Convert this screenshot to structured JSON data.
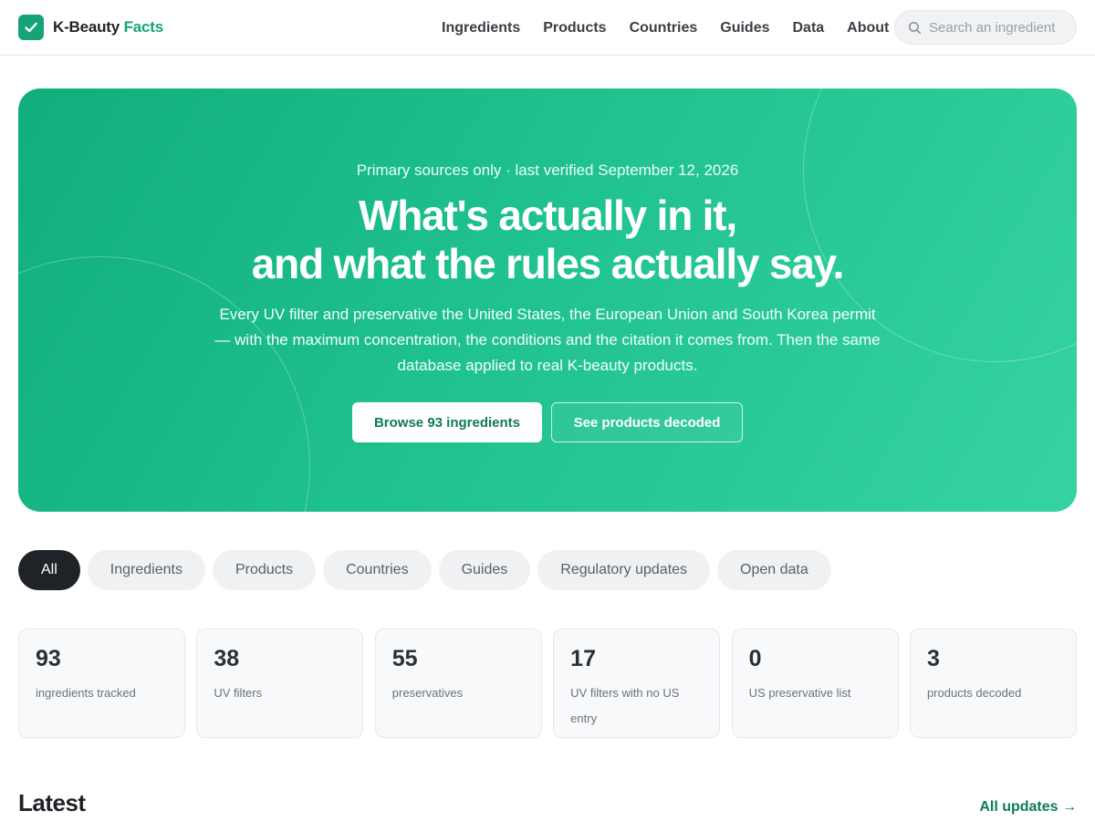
{
  "brand": {
    "name": "K-Beauty",
    "accent": "Facts",
    "color": "#16a37a"
  },
  "nav": [
    "Ingredients",
    "Products",
    "Countries",
    "Guides",
    "Data",
    "About"
  ],
  "search": {
    "placeholder": "Search an ingredient",
    "value": ""
  },
  "hero": {
    "eyebrow": "Primary sources only · last verified September 12, 2026",
    "title_line1": "What's actually in it,",
    "title_line2": "and what the rules actually say.",
    "description": "Every UV filter and preservative the United States, the European Union and South Korea permit — with the maximum concentration, the conditions and the citation it comes from. Then the same database applied to real K-beauty products.",
    "primary_cta": "Browse 93 ingredients",
    "secondary_cta": "See products decoded"
  },
  "filters": [
    "All",
    "Ingredients",
    "Products",
    "Countries",
    "Guides",
    "Regulatory updates",
    "Open data"
  ],
  "active_filter": "All",
  "stats": [
    {
      "value": "93",
      "label": "ingredients tracked"
    },
    {
      "value": "38",
      "label": "UV filters"
    },
    {
      "value": "55",
      "label": "preservatives"
    },
    {
      "value": "17",
      "label": "UV filters with no US entry"
    },
    {
      "value": "0",
      "label": "US preservative list"
    },
    {
      "value": "3",
      "label": "products decoded"
    }
  ],
  "latest": {
    "title": "Latest",
    "link": "All updates →"
  }
}
